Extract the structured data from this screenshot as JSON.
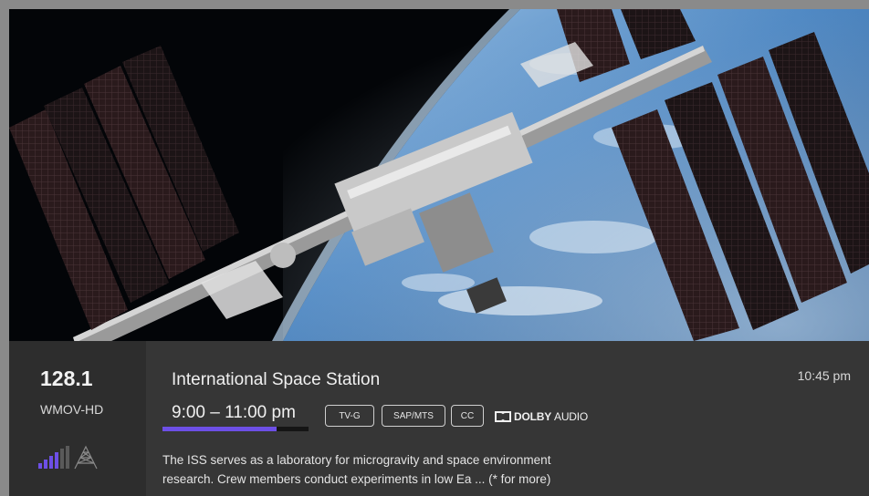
{
  "channel": {
    "number": "128.1",
    "name": "WMOV-HD",
    "signal_icon": "signal-strength-icon"
  },
  "program": {
    "title": "International Space Station",
    "time_range": "9:00 – 11:00 pm",
    "progress": 0.78,
    "badges": [
      "TV-G",
      "SAP/MTS",
      "CC"
    ],
    "dolby": {
      "brand": "DOLBY",
      "suffix": "AUDIO"
    },
    "description_line1": "The ISS serves as a laboratory for microgravity and space environment",
    "description_line2": "research. Crew members conduct experiments in low Ea ... (* for more)"
  },
  "clock": "10:45 pm",
  "colors": {
    "progress_accent": "#6d4fe6",
    "info_background": "#363636",
    "channel_background": "#2d2d2d"
  }
}
